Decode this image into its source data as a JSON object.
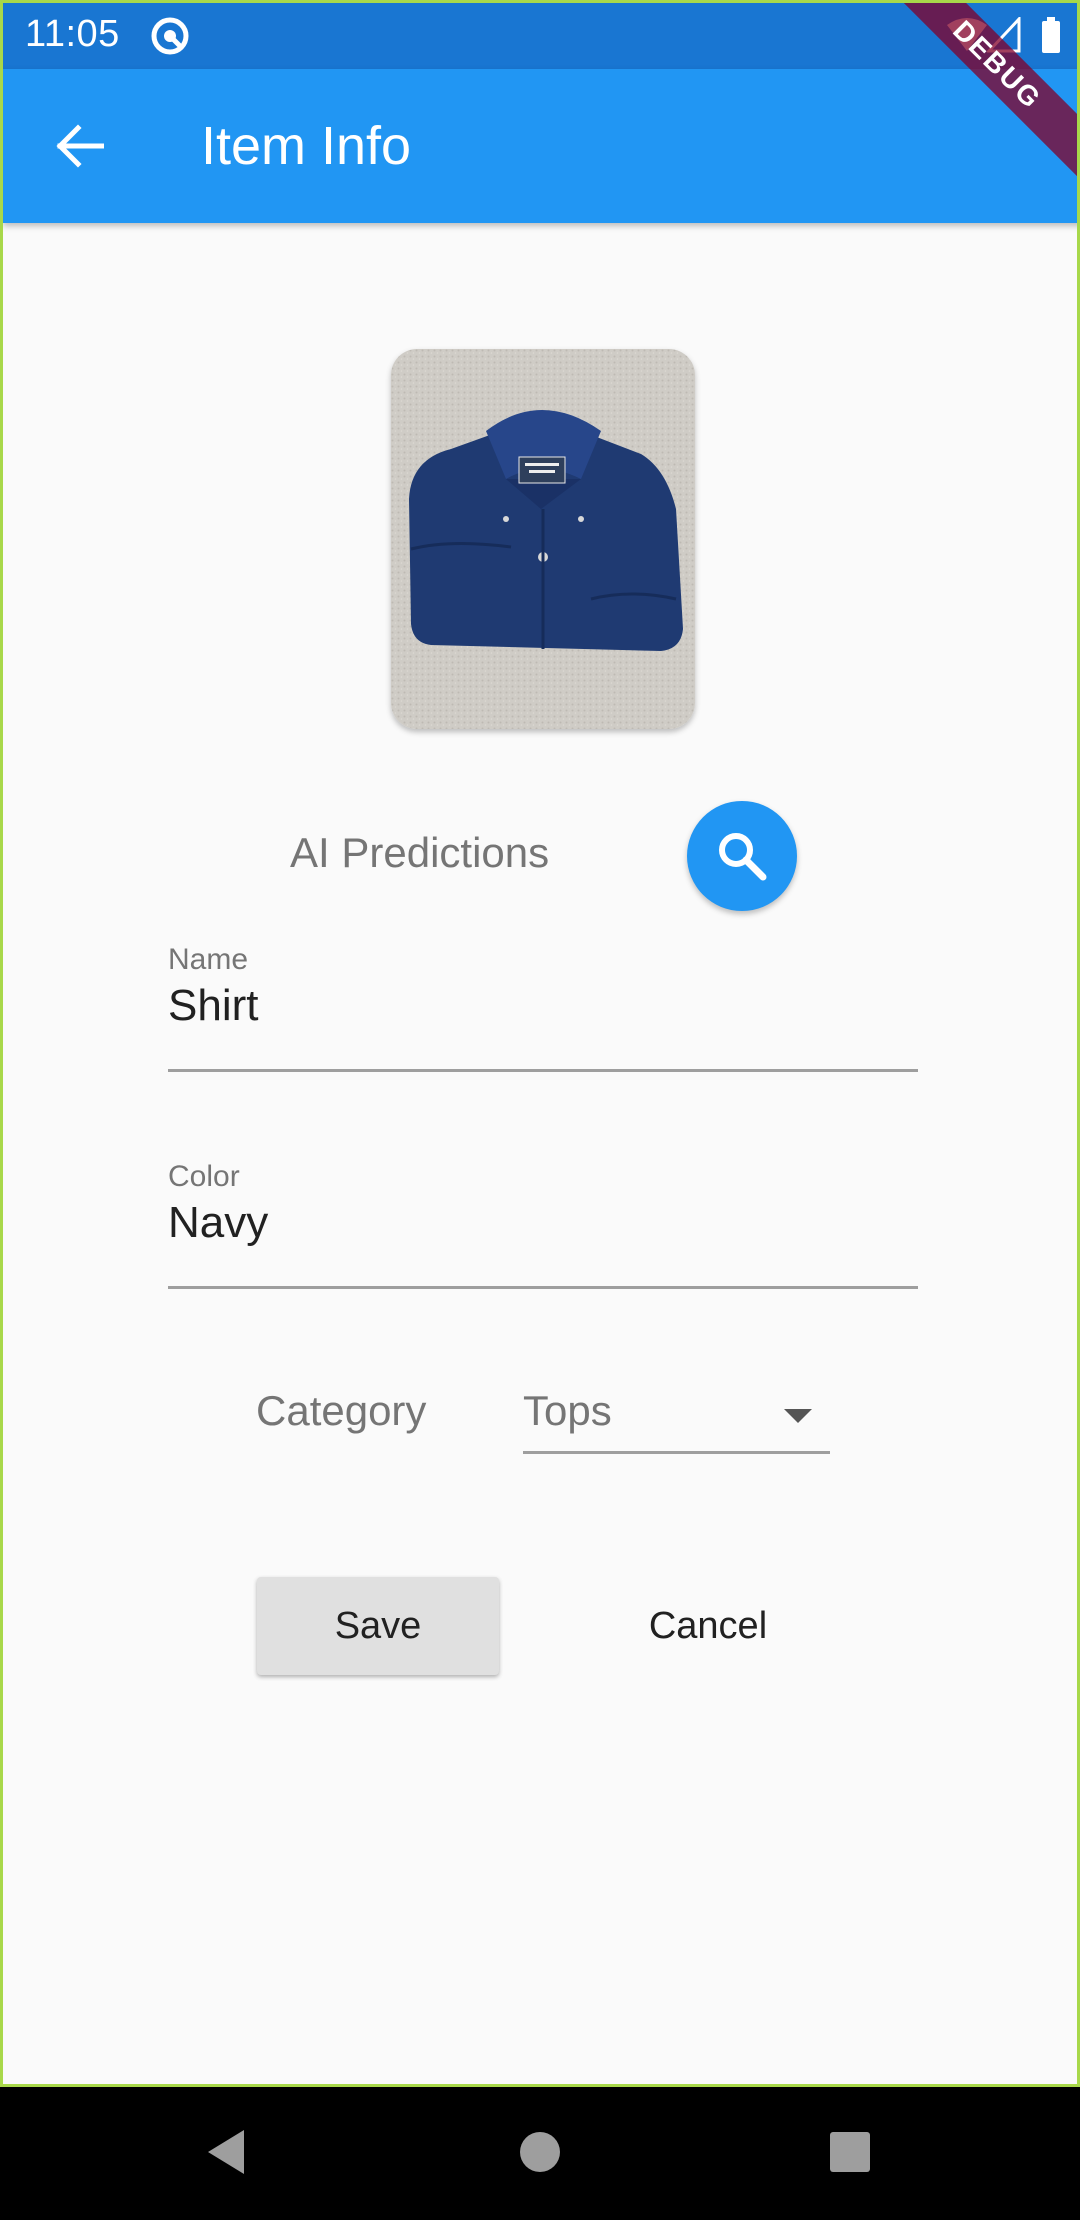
{
  "status_bar": {
    "time": "11:05"
  },
  "app_bar": {
    "title": "Item Info",
    "debug_banner": "DEBUG"
  },
  "ai": {
    "label": "AI Predictions"
  },
  "fields": {
    "name": {
      "label": "Name",
      "value": "Shirt"
    },
    "color": {
      "label": "Color",
      "value": "Navy"
    }
  },
  "category": {
    "label": "Category",
    "selected": "Tops"
  },
  "actions": {
    "save_label": "Save",
    "cancel_label": "Cancel"
  },
  "colors": {
    "status_bar": "#1976d2",
    "app_bar": "#2196f3",
    "accent": "#2196f3",
    "background": "#fafafa"
  },
  "icons": {
    "back": "arrow-back-icon",
    "search": "search-icon",
    "nav_back": "triangle-back-icon",
    "nav_home": "circle-home-icon",
    "nav_recents": "square-recents-icon"
  }
}
